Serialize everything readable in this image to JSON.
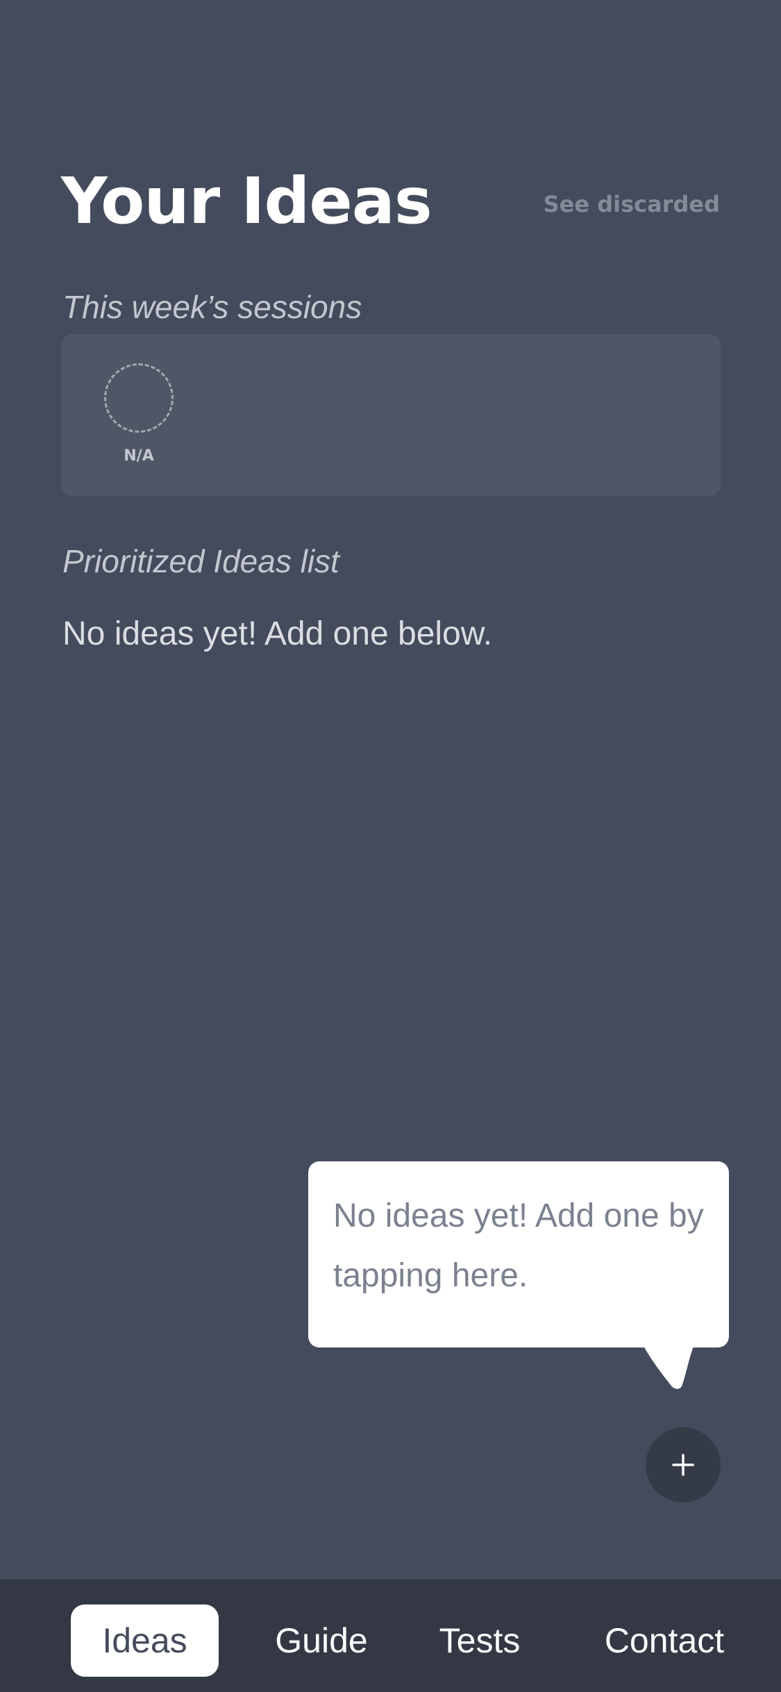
{
  "header": {
    "title": "Your Ideas",
    "see_discarded_label": "See discarded"
  },
  "sessions": {
    "heading": "This week’s sessions",
    "items": [
      {
        "label": "N/A"
      }
    ]
  },
  "ideas": {
    "heading": "Prioritized Ideas list",
    "empty_text": "No ideas yet! Add one below."
  },
  "tooltip": {
    "text": "No ideas yet! Add one by tapping here."
  },
  "fab": {
    "icon": "plus-icon"
  },
  "tabs": [
    {
      "label": "Ideas",
      "active": true
    },
    {
      "label": "Guide",
      "active": false
    },
    {
      "label": "Tests",
      "active": false
    },
    {
      "label": "Contact",
      "active": false
    }
  ],
  "colors": {
    "background": "#434b5c",
    "card": "#4f5666",
    "tab_bar": "#333844",
    "fab": "#353a47",
    "muted_text": "#848a97"
  }
}
